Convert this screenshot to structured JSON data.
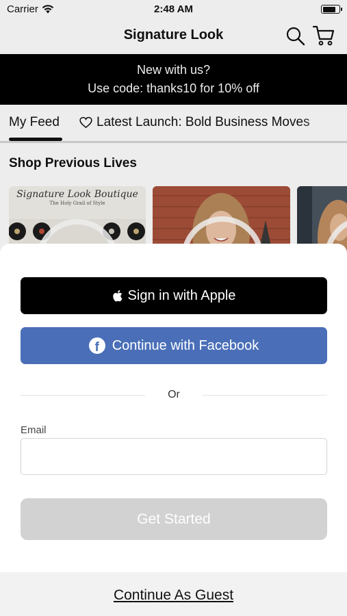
{
  "status_bar": {
    "carrier": "Carrier",
    "time": "2:48 AM",
    "battery_level": 0.85
  },
  "nav": {
    "title": "Signature Look",
    "search_icon": "search-icon",
    "cart_icon": "cart-icon"
  },
  "promo": {
    "line1": "New with us?",
    "line2": "Use code: thanks10 for 10% off"
  },
  "feed_tabs": [
    {
      "label": "My Feed",
      "active": true
    },
    {
      "label": "Latest Launch: Bold Business Moves",
      "icon": "heart-icon",
      "active": false
    }
  ],
  "section": {
    "title": "Shop Previous Lives"
  },
  "live_cards": [
    {
      "title": "Signature Look Boutique",
      "subtitle": "The Holy Grail of Style"
    },
    {
      "title": "",
      "subtitle": ""
    },
    {
      "title": "",
      "subtitle": ""
    }
  ],
  "sheet": {
    "apple_label": "Sign in with Apple",
    "facebook_label": "Continue with Facebook",
    "divider_text": "Or",
    "email_label": "Email",
    "email_value": "",
    "email_placeholder": "",
    "get_started_label": "Get Started",
    "guest_label": "Continue As Guest"
  },
  "colors": {
    "facebook_blue": "#4a6fb8",
    "apple_black": "#000000",
    "disabled_gray": "#d2d2d2",
    "promo_background": "#000000"
  }
}
